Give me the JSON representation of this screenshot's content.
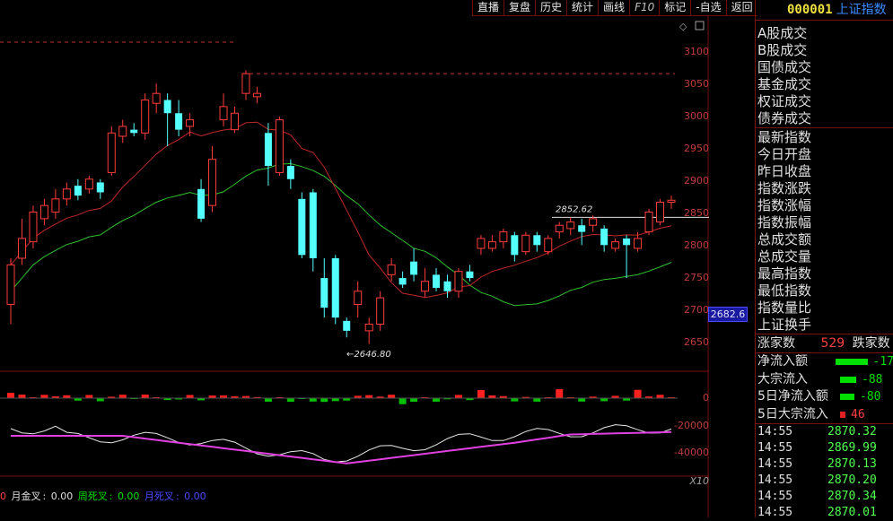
{
  "toolbar": {
    "items": [
      "直播",
      "复盘",
      "历史",
      "统计",
      "画线",
      "F10",
      "标记",
      "-自选",
      "返回"
    ]
  },
  "chart_data": {
    "type": "candlestick",
    "price_axis": {
      "ticks": [
        "3100",
        "3050",
        "3000",
        "2950",
        "2900",
        "2850",
        "2800",
        "2750",
        "2700",
        "2650"
      ],
      "range": [
        2620,
        3130
      ]
    },
    "current_price_badge": "2682.6",
    "annotations": {
      "high_label": "2852.62",
      "low_label": "2646.80"
    },
    "candles": [
      {
        "o": 2720,
        "c": 2780,
        "h": 2790,
        "l": 2690
      },
      {
        "o": 2790,
        "c": 2820,
        "h": 2850,
        "l": 2780
      },
      {
        "o": 2815,
        "c": 2860,
        "h": 2870,
        "l": 2805
      },
      {
        "o": 2850,
        "c": 2870,
        "h": 2880,
        "l": 2840
      },
      {
        "o": 2860,
        "c": 2880,
        "h": 2895,
        "l": 2850
      },
      {
        "o": 2880,
        "c": 2895,
        "h": 2905,
        "l": 2870
      },
      {
        "o": 2900,
        "c": 2885,
        "h": 2910,
        "l": 2878
      },
      {
        "o": 2895,
        "c": 2910,
        "h": 2915,
        "l": 2888
      },
      {
        "o": 2905,
        "c": 2890,
        "h": 2910,
        "l": 2880
      },
      {
        "o": 2920,
        "c": 2980,
        "h": 2990,
        "l": 2915
      },
      {
        "o": 2975,
        "c": 2990,
        "h": 3000,
        "l": 2965
      },
      {
        "o": 2985,
        "c": 2980,
        "h": 2995,
        "l": 2975
      },
      {
        "o": 2980,
        "c": 3030,
        "h": 3040,
        "l": 2970
      },
      {
        "o": 3025,
        "c": 3040,
        "h": 3055,
        "l": 3010
      },
      {
        "o": 3030,
        "c": 3010,
        "h": 3040,
        "l": 2960
      },
      {
        "o": 3010,
        "c": 2985,
        "h": 3030,
        "l": 2975
      },
      {
        "o": 2990,
        "c": 3000,
        "h": 3010,
        "l": 2975
      },
      {
        "o": 2895,
        "c": 2850,
        "h": 2910,
        "l": 2845
      },
      {
        "o": 2870,
        "c": 2940,
        "h": 2960,
        "l": 2860
      },
      {
        "o": 3000,
        "c": 3020,
        "h": 3040,
        "l": 2990
      },
      {
        "o": 2985,
        "c": 3010,
        "h": 3020,
        "l": 2980
      },
      {
        "o": 3040,
        "c": 3070,
        "h": 3075,
        "l": 3030
      },
      {
        "o": 3035,
        "c": 3040,
        "h": 3050,
        "l": 3025
      },
      {
        "o": 2980,
        "c": 2930,
        "h": 2995,
        "l": 2900
      },
      {
        "o": 2920,
        "c": 3000,
        "h": 3005,
        "l": 2915
      },
      {
        "o": 2930,
        "c": 2910,
        "h": 2940,
        "l": 2895
      },
      {
        "o": 2880,
        "c": 2795,
        "h": 2890,
        "l": 2790
      },
      {
        "o": 2890,
        "c": 2790,
        "h": 2895,
        "l": 2770
      },
      {
        "o": 2760,
        "c": 2715,
        "h": 2790,
        "l": 2700
      },
      {
        "o": 2790,
        "c": 2700,
        "h": 2795,
        "l": 2690
      },
      {
        "o": 2695,
        "c": 2680,
        "h": 2700,
        "l": 2670
      },
      {
        "o": 2720,
        "c": 2740,
        "h": 2755,
        "l": 2700
      },
      {
        "o": 2680,
        "c": 2690,
        "h": 2700,
        "l": 2660
      },
      {
        "o": 2690,
        "c": 2730,
        "h": 2740,
        "l": 2680
      },
      {
        "o": 2765,
        "c": 2780,
        "h": 2790,
        "l": 2755
      },
      {
        "o": 2760,
        "c": 2750,
        "h": 2770,
        "l": 2745
      },
      {
        "o": 2785,
        "c": 2765,
        "h": 2805,
        "l": 2755
      },
      {
        "o": 2740,
        "c": 2755,
        "h": 2775,
        "l": 2730
      },
      {
        "o": 2765,
        "c": 2745,
        "h": 2775,
        "l": 2740
      },
      {
        "o": 2755,
        "c": 2740,
        "h": 2765,
        "l": 2730
      },
      {
        "o": 2740,
        "c": 2770,
        "h": 2775,
        "l": 2730
      },
      {
        "o": 2770,
        "c": 2760,
        "h": 2780,
        "l": 2755
      },
      {
        "o": 2805,
        "c": 2820,
        "h": 2825,
        "l": 2795
      },
      {
        "o": 2805,
        "c": 2815,
        "h": 2825,
        "l": 2800
      },
      {
        "o": 2815,
        "c": 2830,
        "h": 2835,
        "l": 2805
      },
      {
        "o": 2825,
        "c": 2795,
        "h": 2830,
        "l": 2785
      },
      {
        "o": 2800,
        "c": 2825,
        "h": 2830,
        "l": 2795
      },
      {
        "o": 2825,
        "c": 2810,
        "h": 2830,
        "l": 2800
      },
      {
        "o": 2800,
        "c": 2820,
        "h": 2825,
        "l": 2795
      },
      {
        "o": 2830,
        "c": 2840,
        "h": 2845,
        "l": 2820
      },
      {
        "o": 2835,
        "c": 2845,
        "h": 2852,
        "l": 2825
      },
      {
        "o": 2840,
        "c": 2830,
        "h": 2850,
        "l": 2810
      },
      {
        "o": 2840,
        "c": 2850,
        "h": 2855,
        "l": 2830
      },
      {
        "o": 2835,
        "c": 2810,
        "h": 2840,
        "l": 2800
      },
      {
        "o": 2805,
        "c": 2815,
        "h": 2820,
        "l": 2800
      },
      {
        "o": 2820,
        "c": 2810,
        "h": 2825,
        "l": 2760
      },
      {
        "o": 2805,
        "c": 2820,
        "h": 2830,
        "l": 2800
      },
      {
        "o": 2830,
        "c": 2860,
        "h": 2865,
        "l": 2825
      },
      {
        "o": 2845,
        "c": 2875,
        "h": 2880,
        "l": 2840
      },
      {
        "o": 2875,
        "c": 2878,
        "h": 2885,
        "l": 2865
      }
    ],
    "volume_axis": {
      "ticks": [
        "0",
        "-20000",
        "-40000"
      ]
    },
    "volume_axis_note": "X10",
    "indicator_legend": [
      {
        "label": "月金叉",
        "value": "0.00",
        "color": "#ffffff"
      },
      {
        "label": "周死叉",
        "value": "0.00",
        "color": "#00e000"
      },
      {
        "label": "月死叉",
        "value": "0.00",
        "color": "#4a4aff"
      }
    ]
  },
  "right_panel": {
    "code": "000001",
    "name": "上证指数",
    "turnover_items": [
      "A股成交",
      "B股成交",
      "国债成交",
      "基金成交",
      "权证成交",
      "债券成交"
    ],
    "index_items": [
      "最新指数",
      "今日开盘",
      "昨日收盘",
      "指数涨跌",
      "指数涨幅",
      "指数振幅",
      "总成交额",
      "总成交量",
      "最高指数",
      "最低指数",
      "指数量比",
      "上证换手"
    ],
    "advancers_label": "涨家数",
    "advancers_value": "529",
    "decliners_label": "跌家数",
    "flows": [
      {
        "label": "净流入额",
        "value": "-17",
        "bar_fraction": 0.95,
        "color": "green"
      },
      {
        "label": "大宗流入",
        "value": "-88",
        "bar_fraction": 0.45,
        "color": "green"
      },
      {
        "label": "5日净流入额",
        "value": "-80",
        "bar_fraction": 0.4,
        "color": "green"
      },
      {
        "label": "5日大宗流入",
        "value": "46",
        "bar_fraction": 0.15,
        "color": "red"
      }
    ],
    "ticks": [
      {
        "time": "14:55",
        "value": "2870.32"
      },
      {
        "time": "14:55",
        "value": "2869.99"
      },
      {
        "time": "14:55",
        "value": "2870.13"
      },
      {
        "time": "14:55",
        "value": "2870.20"
      },
      {
        "time": "14:55",
        "value": "2870.34"
      },
      {
        "time": "14:55",
        "value": "2870.01"
      }
    ]
  }
}
